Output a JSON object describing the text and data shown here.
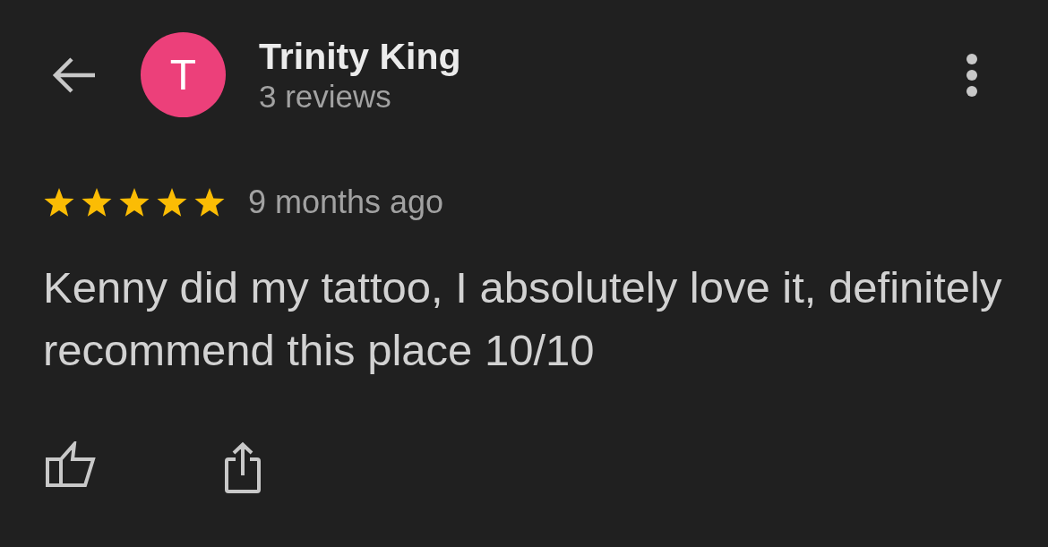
{
  "header": {
    "avatar_letter": "T",
    "name": "Trinity King",
    "review_count": "3 reviews"
  },
  "review": {
    "stars": 5,
    "time": "9 months ago",
    "text": "Kenny did my tattoo, I absolutely love it, definitely recommend this place 10/10"
  }
}
